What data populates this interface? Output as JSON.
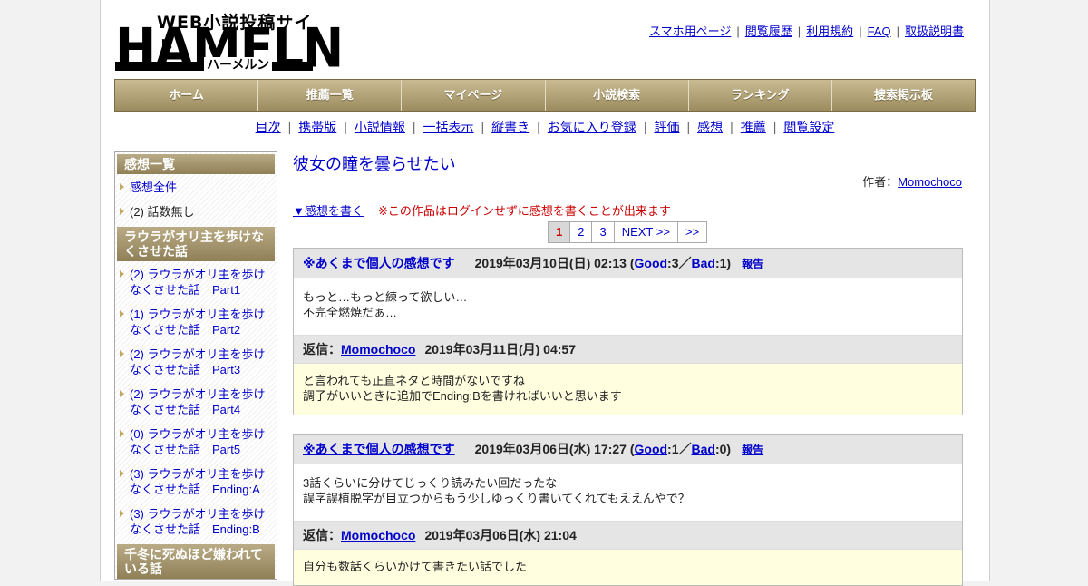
{
  "logo": {
    "tagline": "WEB小説投稿サイト",
    "wordmark": "HAMELN",
    "kana": "ハーメルン"
  },
  "toplinks": [
    "スマホ用ページ",
    "閲覧履歴",
    "利用規約",
    "FAQ",
    "取扱説明書"
  ],
  "mainmenu": [
    "ホーム",
    "推薦一覧",
    "マイページ",
    "小説検索",
    "ランキング",
    "捜索掲示板"
  ],
  "subnav": [
    "目次",
    "携帯版",
    "小説情報",
    "一括表示",
    "縦書き",
    "お気に入り登録",
    "評価",
    "感想",
    "推薦",
    "閲覧設定"
  ],
  "sidebar": {
    "head1": "感想一覧",
    "all": "感想全件",
    "nochapter": "(2) 話数無し",
    "head2": "ラウラがオリ主を歩けなくさせた話",
    "items": [
      "(2) ラウラがオリ主を歩けなくさせた話　Part1",
      "(1) ラウラがオリ主を歩けなくさせた話　Part2",
      "(2) ラウラがオリ主を歩けなくさせた話　Part3",
      "(2) ラウラがオリ主を歩けなくさせた話　Part4",
      "(0) ラウラがオリ主を歩けなくさせた話　Part5",
      "(3) ラウラがオリ主を歩けなくさせた話　Ending:A",
      "(3) ラウラがオリ主を歩けなくさせた話　Ending:B"
    ],
    "head3": "千冬に死ぬほど嫌われている話"
  },
  "content": {
    "title": "彼女の瞳を曇らせたい",
    "author_label": "作者：",
    "author": "Momochoco",
    "write_link": "▼感想を書く",
    "notice": "※この作品はログインせずに感想を書くことが出来ます",
    "pager": [
      "1",
      "2",
      "3",
      "NEXT >>",
      ">>"
    ]
  },
  "reviews": [
    {
      "author": "※あくまで個人の感想です",
      "date_pre": "2019年03月10日(日) 02:13 (",
      "good_label": "Good",
      "good": ":3／",
      "bad_label": "Bad",
      "bad": ":1)",
      "report": "報告",
      "body1": "もっと…もっと練って欲しい…",
      "body2": "不完全燃焼だぁ…",
      "reply_label": "返信：",
      "reply_author": "Momochoco",
      "reply_date": "2019年03月11日(月) 04:57",
      "reply1": "と言われても正直ネタと時間がないですね",
      "reply2": "調子がいいときに追加でEnding:Bを書ければいいと思います"
    },
    {
      "author": "※あくまで個人の感想です",
      "date_pre": "2019年03月06日(水) 17:27 (",
      "good_label": "Good",
      "good": ":1／",
      "bad_label": "Bad",
      "bad": ":0)",
      "report": "報告",
      "body1": "3話くらいに分けてじっくり読みたい回だったな",
      "body2": "誤字誤植脱字が目立つからもう少しゆっくり書いてくれてもええんやで？",
      "reply_label": "返信：",
      "reply_author": "Momochoco",
      "reply_date": "2019年03月06日(水) 21:04",
      "reply1": "自分も数話くらいかけて書きたい話でした",
      "reply2": ""
    }
  ]
}
